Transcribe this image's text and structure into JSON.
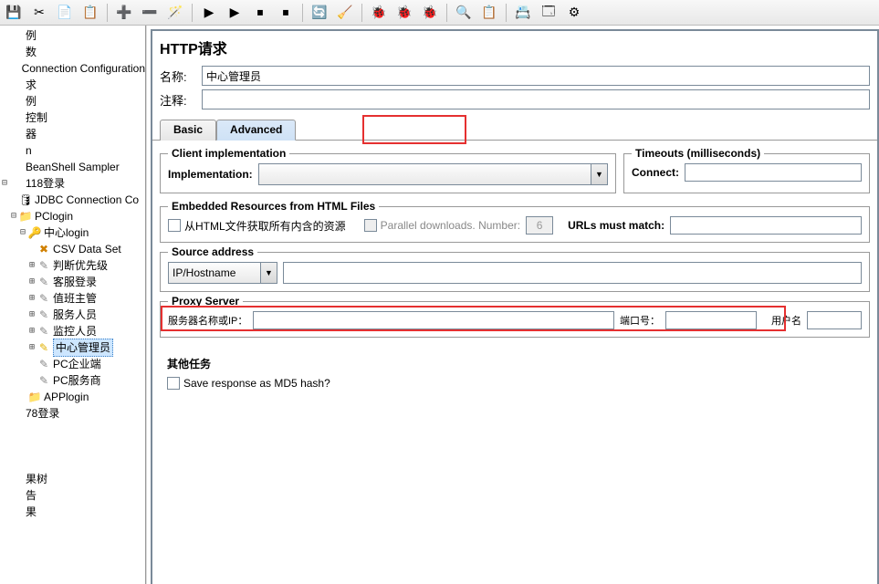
{
  "toolbar_icons": [
    "save-icon",
    "cut-icon",
    "copy-icon",
    "paste-icon",
    "divider",
    "plus-icon",
    "minus-icon",
    "wand-icon",
    "divider",
    "play-icon",
    "play-edit-icon",
    "stop-icon",
    "stop-all-icon",
    "divider",
    "cycle-icon",
    "clear-icon",
    "divider",
    "bug1-icon",
    "bug2-icon",
    "bug3-icon",
    "divider",
    "binoculars-icon",
    "clipboard-icon",
    "divider",
    "list-icon",
    "window-icon",
    "gear-icon"
  ],
  "tree": [
    {
      "lbl": "例",
      "ind": 0,
      "toggle": "",
      "icon": ""
    },
    {
      "lbl": "数",
      "ind": 0,
      "toggle": "",
      "icon": ""
    },
    {
      "lbl": "Connection Configuration",
      "ind": 0,
      "toggle": "",
      "icon": ""
    },
    {
      "lbl": "求",
      "ind": 0,
      "toggle": "",
      "icon": ""
    },
    {
      "lbl": "例",
      "ind": 0,
      "toggle": "",
      "icon": ""
    },
    {
      "lbl": "控制",
      "ind": 0,
      "toggle": "",
      "icon": ""
    },
    {
      "lbl": "器",
      "ind": 0,
      "toggle": "",
      "icon": ""
    },
    {
      "lbl": "n",
      "ind": 0,
      "toggle": "",
      "icon": ""
    },
    {
      "lbl": "BeanShell Sampler",
      "ind": 0,
      "toggle": "",
      "icon": ""
    },
    {
      "lbl": "118登录",
      "ind": 0,
      "toggle": "⊟",
      "icon": ""
    },
    {
      "lbl": "JDBC Connection Co",
      "ind": 1,
      "toggle": "",
      "icon": "icon-db"
    },
    {
      "lbl": "PClogin",
      "ind": 1,
      "toggle": "⊟",
      "icon": "icon-folder"
    },
    {
      "lbl": "中心login",
      "ind": 2,
      "toggle": "⊟",
      "icon": "icon-login"
    },
    {
      "lbl": "CSV Data Set",
      "ind": 3,
      "toggle": "",
      "icon": "icon-xx"
    },
    {
      "lbl": "判断优先级",
      "ind": 3,
      "toggle": "⊞",
      "icon": "icon-pencil"
    },
    {
      "lbl": "客服登录",
      "ind": 3,
      "toggle": "⊞",
      "icon": "icon-pencil"
    },
    {
      "lbl": "值班主管",
      "ind": 3,
      "toggle": "⊞",
      "icon": "icon-pencil"
    },
    {
      "lbl": "服务人员",
      "ind": 3,
      "toggle": "⊞",
      "icon": "icon-pencil"
    },
    {
      "lbl": "监控人员",
      "ind": 3,
      "toggle": "⊞",
      "icon": "icon-pencil"
    },
    {
      "lbl": "中心管理员",
      "ind": 3,
      "toggle": "⊞",
      "icon": "icon-pencil-y",
      "sel": true
    },
    {
      "lbl": "PC企业端",
      "ind": 3,
      "toggle": "",
      "icon": "icon-pencil"
    },
    {
      "lbl": "PC服务商",
      "ind": 3,
      "toggle": "",
      "icon": "icon-pencil"
    },
    {
      "lbl": "APPlogin",
      "ind": 2,
      "toggle": "",
      "icon": "icon-folder"
    },
    {
      "lbl": "78登录",
      "ind": 0,
      "toggle": "",
      "icon": ""
    },
    {
      "lbl": " ",
      "ind": 0,
      "toggle": "",
      "icon": ""
    },
    {
      "lbl": " ",
      "ind": 0,
      "toggle": "",
      "icon": ""
    },
    {
      "lbl": " ",
      "ind": 0,
      "toggle": "",
      "icon": ""
    },
    {
      "lbl": "果树",
      "ind": 0,
      "toggle": "",
      "icon": ""
    },
    {
      "lbl": "告",
      "ind": 0,
      "toggle": "",
      "icon": ""
    },
    {
      "lbl": "果",
      "ind": 0,
      "toggle": "",
      "icon": ""
    }
  ],
  "panel": {
    "title": "HTTP请求",
    "name_label": "名称:",
    "name_value": "中心管理员",
    "comment_label": "注释:",
    "comment_value": ""
  },
  "tabs": {
    "basic": "Basic",
    "advanced": "Advanced"
  },
  "client_impl": {
    "title": "Client implementation",
    "label": "Implementation:"
  },
  "timeouts": {
    "title": "Timeouts (milliseconds)",
    "label": "Connect:"
  },
  "embedded": {
    "title": "Embedded Resources from HTML Files",
    "chk1": "从HTML文件获取所有内含的资源",
    "chk2": "Parallel downloads. Number:",
    "num": "6",
    "match_label": "URLs must match:"
  },
  "source": {
    "title": "Source address",
    "combo": "IP/Hostname"
  },
  "proxy": {
    "title": "Proxy Server",
    "ip_label": "服务器名称或IP：",
    "port_label": "端口号：",
    "user_label": "用户名"
  },
  "other": {
    "title": "其他任务",
    "chk": "Save response as MD5 hash?"
  }
}
